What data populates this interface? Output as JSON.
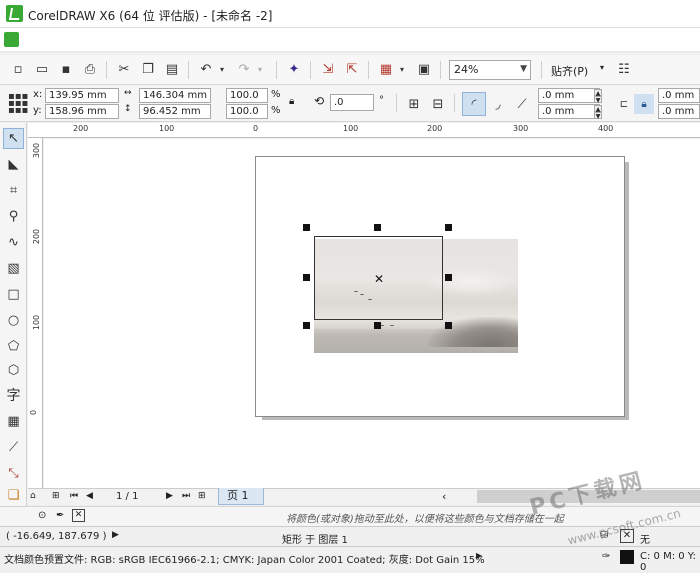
{
  "window": {
    "title": "CorelDRAW X6 (64 位 评估版) - [未命名 -2]"
  },
  "toolbar": {
    "zoom_value": "24%",
    "snap_label": "贴齐(P)"
  },
  "propbar": {
    "x_label": "x:",
    "x_value": "139.95 mm",
    "y_label": "y:",
    "y_value": "158.96 mm",
    "w_value": "146.304 mm",
    "h_value": "96.452 mm",
    "scale_w": "100.0",
    "scale_h": "100.0",
    "pct": "%",
    "rotation": ".0",
    "corner1": ".0 mm",
    "corner2": ".0 mm",
    "corner3": ".0 mm",
    "corner4": ".0 mm"
  },
  "hruler_ticks": [
    "200",
    "100",
    "0",
    "100",
    "200",
    "300",
    "400"
  ],
  "vruler_ticks": [
    "300",
    "200",
    "100",
    "0"
  ],
  "pagenav": {
    "page_count": "1 / 1",
    "page_tab": "页 1"
  },
  "palette_hint": "将颜色(或对象)拖动至此处，以便将这些颜色与文档存储在一起",
  "status": {
    "coords": "( -16.649, 187.679 )",
    "object_info": "矩形 于 图层 1",
    "color_profile": "文档颜色预置文件: RGB: sRGB IEC61966-2.1; CMYK: Japan Color 2001 Coated; 灰度: Dot Gain 15%",
    "fill_none": "无",
    "outline_color": "C: 0 M: 0 Y: 0"
  },
  "watermark": {
    "text": "PC下载网",
    "url": "www.pcsoft.com.cn"
  }
}
